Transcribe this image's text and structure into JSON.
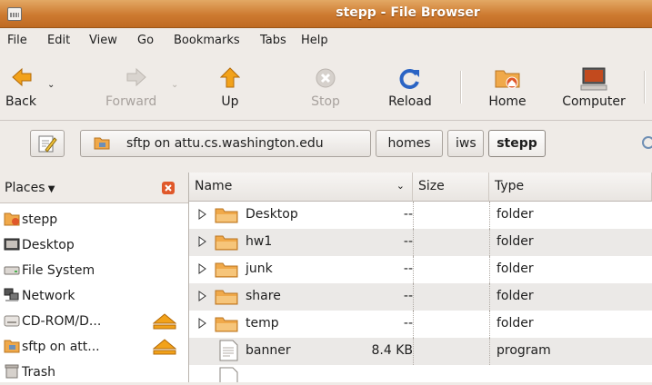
{
  "window": {
    "title": "stepp - File Browser"
  },
  "menu": [
    "File",
    "Edit",
    "View",
    "Go",
    "Bookmarks",
    "Tabs",
    "Help"
  ],
  "toolbar": {
    "back": "Back",
    "forward": "Forward",
    "up": "Up",
    "stop": "Stop",
    "reload": "Reload",
    "home": "Home",
    "computer": "Computer"
  },
  "location": {
    "root": "sftp on attu.cs.washington.edu",
    "crumbs": [
      "homes",
      "iws",
      "stepp"
    ]
  },
  "sidebar": {
    "header": "Places",
    "items": [
      {
        "label": "stepp"
      },
      {
        "label": "Desktop"
      },
      {
        "label": "File System"
      },
      {
        "label": "Network"
      },
      {
        "label": "CD-ROM/D..."
      },
      {
        "label": "sftp on att..."
      },
      {
        "label": "Trash"
      }
    ]
  },
  "columns": {
    "name": "Name",
    "size": "Size",
    "type": "Type"
  },
  "files": [
    {
      "name": "Desktop",
      "size": "--",
      "type": "folder"
    },
    {
      "name": "hw1",
      "size": "--",
      "type": "folder"
    },
    {
      "name": "junk",
      "size": "--",
      "type": "folder"
    },
    {
      "name": "share",
      "size": "--",
      "type": "folder"
    },
    {
      "name": "temp",
      "size": "--",
      "type": "folder"
    },
    {
      "name": "banner",
      "size": "8.4 KB",
      "type": "program"
    }
  ],
  "colors": {
    "titlebar": "#cd7a30",
    "folder": "#f0a94a",
    "accent": "#e0582a"
  }
}
